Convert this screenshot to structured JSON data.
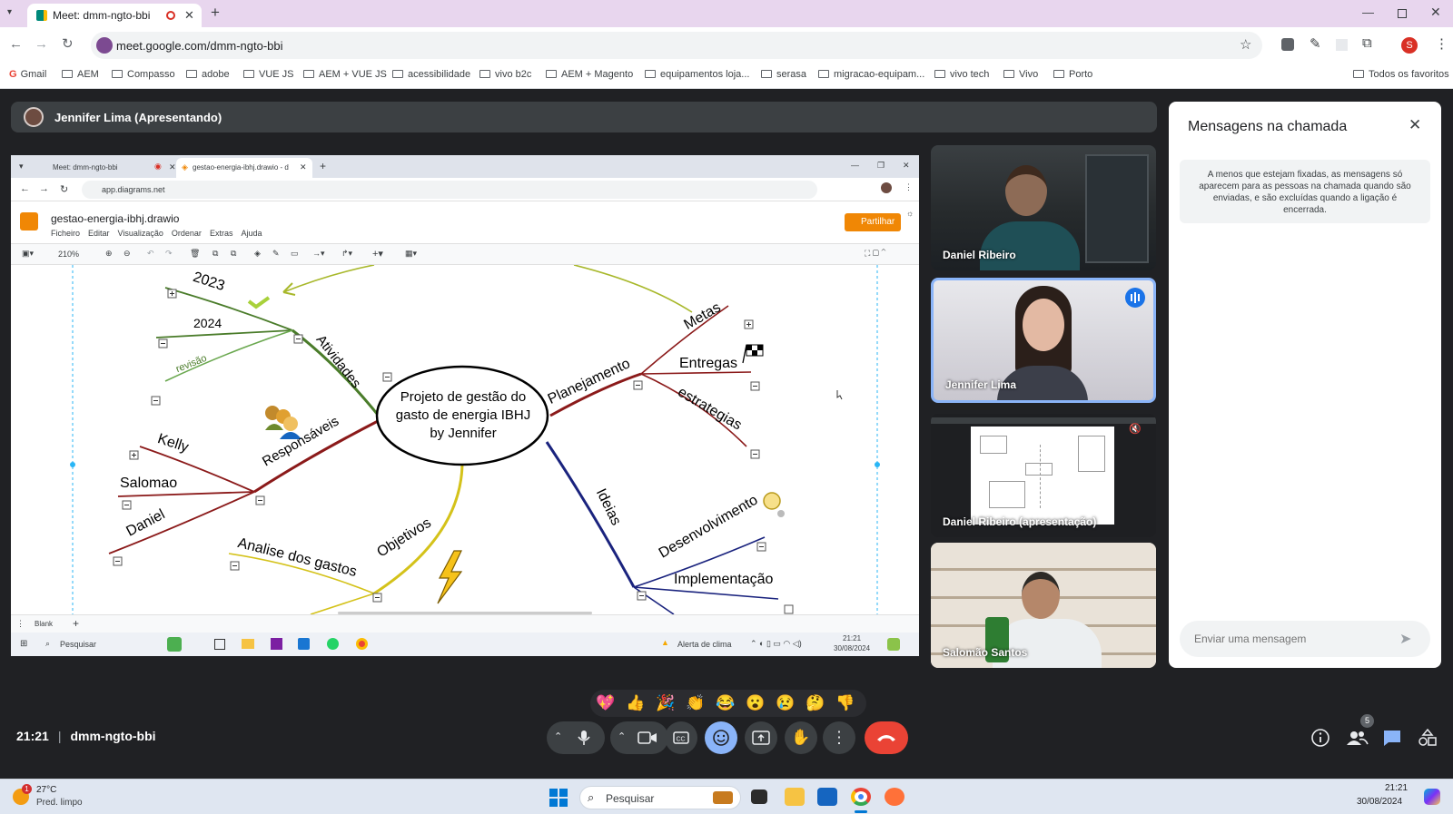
{
  "browser": {
    "tab_title": "Meet: dmm-ngto-bbi",
    "url": "meet.google.com/dmm-ngto-bbi",
    "profile_initial": "S",
    "bookmarks": [
      "Gmail",
      "AEM",
      "Compasso",
      "adobe",
      "VUE JS",
      "AEM + VUE JS",
      "acessibilidade",
      "vivo b2c",
      "AEM + Magento",
      "equipamentos loja...",
      "serasa",
      "migracao-equipam...",
      "vivo tech",
      "Vivo",
      "Porto"
    ],
    "favorites_label": "Todos os favoritos"
  },
  "meet": {
    "presenter_label": "Jennifer Lima (Apresentando)",
    "meeting_code": "dmm-ngto-bbi",
    "time": "21:21",
    "people_count": "5",
    "accent_color": "#8ab4f8",
    "end_call_color": "#ea4335",
    "participants": [
      {
        "name": "Daniel Ribeiro"
      },
      {
        "name": "Jennifer Lima",
        "speaking": true
      },
      {
        "name": "Daniel Ribeiro (apresentação)",
        "muted": true
      },
      {
        "name": "Salomão Santos"
      }
    ],
    "chat": {
      "title": "Mensagens na chamada",
      "info": "A menos que estejam fixadas, as mensagens só aparecem para as pessoas na chamada quando são enviadas, e são excluídas quando a ligação é encerrada.",
      "input_placeholder": "Enviar uma mensagem"
    },
    "reactions": [
      "💖",
      "👍",
      "🎉",
      "👏",
      "😂",
      "😮",
      "😢",
      "🤔",
      "👎"
    ],
    "controls": [
      "chevron-up-icon",
      "mic-icon",
      "chevron-up-icon",
      "camera-icon",
      "captions-icon",
      "emoji-icon",
      "present-icon",
      "raise-hand-icon",
      "more-icon",
      "end-call-icon"
    ]
  },
  "shared_screen": {
    "tabs": [
      "Meet: dmm-ngto-bbi",
      "gestao-energia-ibhj.drawio - d"
    ],
    "url": "app.diagrams.net",
    "file_name": "gestao-energia-ibhj.drawio",
    "menu": [
      "Ficheiro",
      "Editar",
      "Visualização",
      "Ordenar",
      "Extras",
      "Ajuda"
    ],
    "share_label": "Partilhar",
    "zoom": "210%",
    "page_tab": "Blank",
    "taskbar_search": "Pesquisar",
    "weather_alert": "Alerta de clima",
    "clock_time": "21:21",
    "clock_date": "30/08/2024",
    "mindmap": {
      "center": [
        "Projeto de gestão do",
        "gasto de energia IBHJ",
        "by Jennifer"
      ],
      "branches": {
        "atividades": "Atividades",
        "year_2023": "2023",
        "year_2024": "2024",
        "revisao": "revisão",
        "responsaveis": "Responsáveis",
        "kelly": "Kelly",
        "salomao": "Salomao",
        "daniel": "Daniel",
        "planejamento": "Planejamento",
        "metas": "Metas",
        "entregas": "Entregas",
        "estrategias": "estrategias",
        "ideias": "Ideias",
        "desenvolvimento": "Desenvolvimento",
        "implementacao": "Implementação",
        "objetivos": "Objetivos",
        "analise": "Analise dos gastos"
      }
    }
  },
  "windows": {
    "temperature": "27°C",
    "weather": "Pred. limpo",
    "notification_badge": "1",
    "search_placeholder": "Pesquisar",
    "time": "21:21",
    "date": "30/08/2024"
  }
}
